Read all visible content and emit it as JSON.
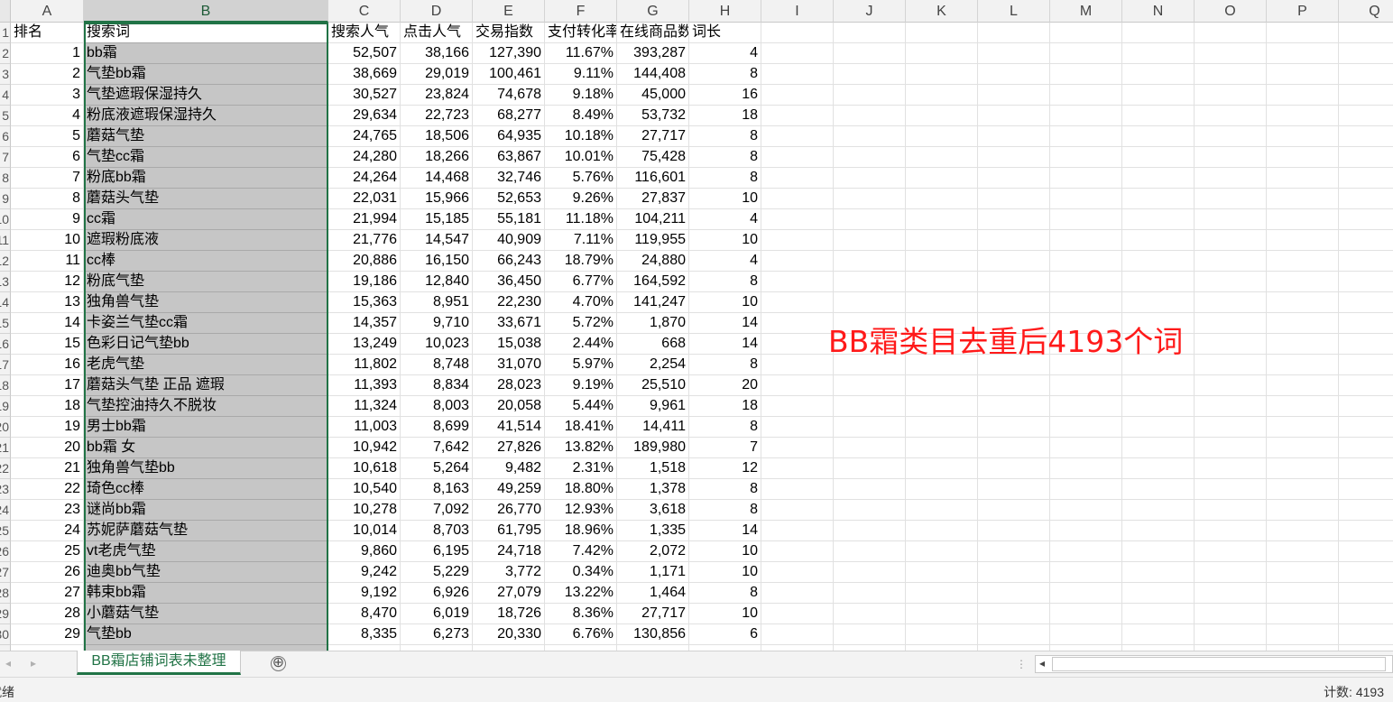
{
  "columns": [
    "A",
    "B",
    "C",
    "D",
    "E",
    "F",
    "G",
    "H",
    "I",
    "J",
    "K",
    "L",
    "M",
    "N",
    "O",
    "P",
    "Q"
  ],
  "header_row": {
    "row_num": "1",
    "cells": [
      "排名",
      "搜索词",
      "搜索人气",
      "点击人气",
      "交易指数",
      "支付转化率",
      "在线商品数",
      "词长"
    ]
  },
  "rows": [
    {
      "row_num": "2",
      "cells": [
        "1",
        "bb霜",
        "52,507",
        "38,166",
        "127,390",
        "11.67%",
        "393,287",
        "4"
      ]
    },
    {
      "row_num": "3",
      "cells": [
        "2",
        "气垫bb霜",
        "38,669",
        "29,019",
        "100,461",
        "9.11%",
        "144,408",
        "8"
      ]
    },
    {
      "row_num": "4",
      "cells": [
        "3",
        "气垫遮瑕保湿持久",
        "30,527",
        "23,824",
        "74,678",
        "9.18%",
        "45,000",
        "16"
      ]
    },
    {
      "row_num": "5",
      "cells": [
        "4",
        "粉底液遮瑕保湿持久",
        "29,634",
        "22,723",
        "68,277",
        "8.49%",
        "53,732",
        "18"
      ]
    },
    {
      "row_num": "6",
      "cells": [
        "5",
        "蘑菇气垫",
        "24,765",
        "18,506",
        "64,935",
        "10.18%",
        "27,717",
        "8"
      ]
    },
    {
      "row_num": "7",
      "cells": [
        "6",
        "气垫cc霜",
        "24,280",
        "18,266",
        "63,867",
        "10.01%",
        "75,428",
        "8"
      ]
    },
    {
      "row_num": "8",
      "cells": [
        "7",
        "粉底bb霜",
        "24,264",
        "14,468",
        "32,746",
        "5.76%",
        "116,601",
        "8"
      ]
    },
    {
      "row_num": "9",
      "cells": [
        "8",
        "蘑菇头气垫",
        "22,031",
        "15,966",
        "52,653",
        "9.26%",
        "27,837",
        "10"
      ]
    },
    {
      "row_num": "10",
      "cells": [
        "9",
        "cc霜",
        "21,994",
        "15,185",
        "55,181",
        "11.18%",
        "104,211",
        "4"
      ]
    },
    {
      "row_num": "11",
      "cells": [
        "10",
        "遮瑕粉底液",
        "21,776",
        "14,547",
        "40,909",
        "7.11%",
        "119,955",
        "10"
      ]
    },
    {
      "row_num": "12",
      "cells": [
        "11",
        "cc棒",
        "20,886",
        "16,150",
        "66,243",
        "18.79%",
        "24,880",
        "4"
      ]
    },
    {
      "row_num": "13",
      "cells": [
        "12",
        "粉底气垫",
        "19,186",
        "12,840",
        "36,450",
        "6.77%",
        "164,592",
        "8"
      ]
    },
    {
      "row_num": "14",
      "cells": [
        "13",
        "独角兽气垫",
        "15,363",
        "8,951",
        "22,230",
        "4.70%",
        "141,247",
        "10"
      ]
    },
    {
      "row_num": "15",
      "cells": [
        "14",
        "卡姿兰气垫cc霜",
        "14,357",
        "9,710",
        "33,671",
        "5.72%",
        "1,870",
        "14"
      ]
    },
    {
      "row_num": "16",
      "cells": [
        "15",
        "色彩日记气垫bb",
        "13,249",
        "10,023",
        "15,038",
        "2.44%",
        "668",
        "14"
      ]
    },
    {
      "row_num": "17",
      "cells": [
        "16",
        "老虎气垫",
        "11,802",
        "8,748",
        "31,070",
        "5.97%",
        "2,254",
        "8"
      ]
    },
    {
      "row_num": "18",
      "cells": [
        "17",
        "蘑菇头气垫 正品 遮瑕",
        "11,393",
        "8,834",
        "28,023",
        "9.19%",
        "25,510",
        "20"
      ]
    },
    {
      "row_num": "19",
      "cells": [
        "18",
        "气垫控油持久不脱妆",
        "11,324",
        "8,003",
        "20,058",
        "5.44%",
        "9,961",
        "18"
      ]
    },
    {
      "row_num": "20",
      "cells": [
        "19",
        "男士bb霜",
        "11,003",
        "8,699",
        "41,514",
        "18.41%",
        "14,411",
        "8"
      ]
    },
    {
      "row_num": "21",
      "cells": [
        "20",
        "bb霜 女",
        "10,942",
        "7,642",
        "27,826",
        "13.82%",
        "189,980",
        "7"
      ]
    },
    {
      "row_num": "22",
      "cells": [
        "21",
        "独角兽气垫bb",
        "10,618",
        "5,264",
        "9,482",
        "2.31%",
        "1,518",
        "12"
      ]
    },
    {
      "row_num": "23",
      "cells": [
        "22",
        "琦色cc棒",
        "10,540",
        "8,163",
        "49,259",
        "18.80%",
        "1,378",
        "8"
      ]
    },
    {
      "row_num": "24",
      "cells": [
        "23",
        "谜尚bb霜",
        "10,278",
        "7,092",
        "26,770",
        "12.93%",
        "3,618",
        "8"
      ]
    },
    {
      "row_num": "25",
      "cells": [
        "24",
        "苏妮萨蘑菇气垫",
        "10,014",
        "8,703",
        "61,795",
        "18.96%",
        "1,335",
        "14"
      ]
    },
    {
      "row_num": "26",
      "cells": [
        "25",
        "vt老虎气垫",
        "9,860",
        "6,195",
        "24,718",
        "7.42%",
        "2,072",
        "10"
      ]
    },
    {
      "row_num": "27",
      "cells": [
        "26",
        "迪奥bb气垫",
        "9,242",
        "5,229",
        "3,772",
        "0.34%",
        "1,171",
        "10"
      ]
    },
    {
      "row_num": "28",
      "cells": [
        "27",
        "韩束bb霜",
        "9,192",
        "6,926",
        "27,079",
        "13.22%",
        "1,464",
        "8"
      ]
    },
    {
      "row_num": "29",
      "cells": [
        "28",
        "小蘑菇气垫",
        "8,470",
        "6,019",
        "18,726",
        "8.36%",
        "27,717",
        "10"
      ]
    },
    {
      "row_num": "30",
      "cells": [
        "29",
        "气垫bb",
        "8,335",
        "6,273",
        "20,330",
        "6.76%",
        "130,856",
        "6"
      ]
    }
  ],
  "annotation": "BB霜类目去重后4193个词",
  "annotation_color": "#ff1a1a",
  "selection_color": "#217346",
  "sheet_tab": "BB霜店铺词表未整理",
  "add_sheet_icon": "⊕",
  "status": {
    "ready": "就绪",
    "count": "计数: 4193"
  }
}
